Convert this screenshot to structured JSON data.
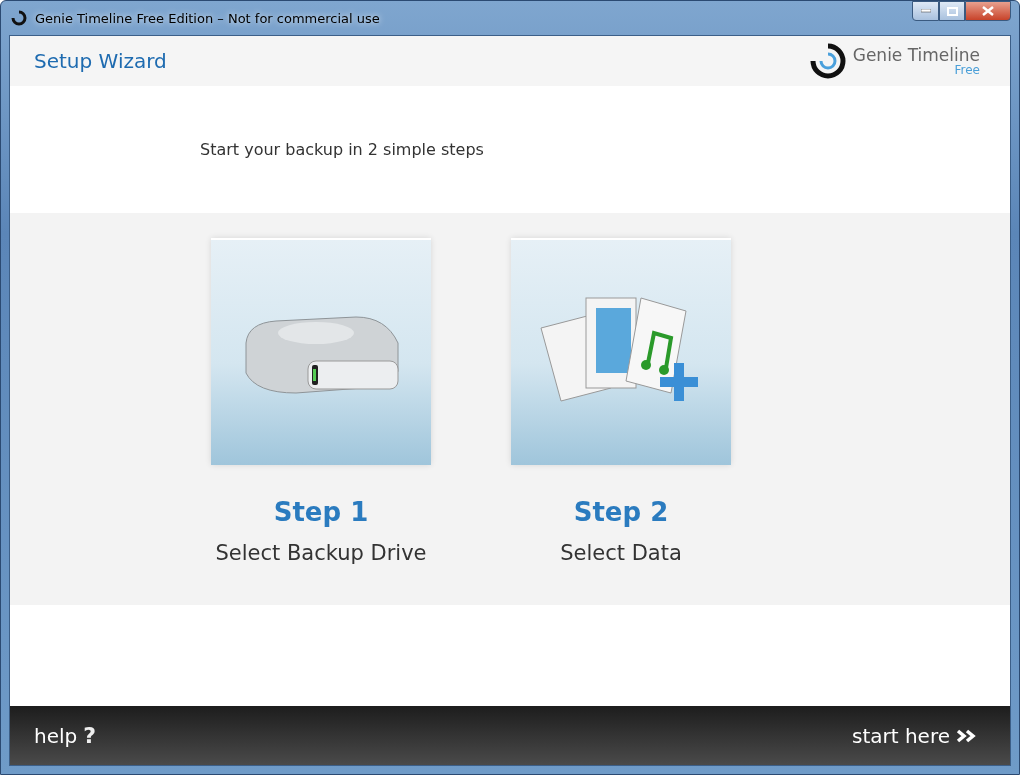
{
  "window": {
    "title": "Genie Timeline Free Edition – Not for commercial use"
  },
  "header": {
    "title": "Setup Wizard",
    "brand": "Genie Timeline",
    "edition": "Free"
  },
  "subtitle": "Start your backup in 2 simple steps",
  "steps": [
    {
      "kind": "drive",
      "title": "Step 1",
      "label": "Select Backup Drive"
    },
    {
      "kind": "data",
      "title": "Step 2",
      "label": "Select Data"
    }
  ],
  "footer": {
    "help": "help",
    "help_mark": "?",
    "start": "start here"
  }
}
